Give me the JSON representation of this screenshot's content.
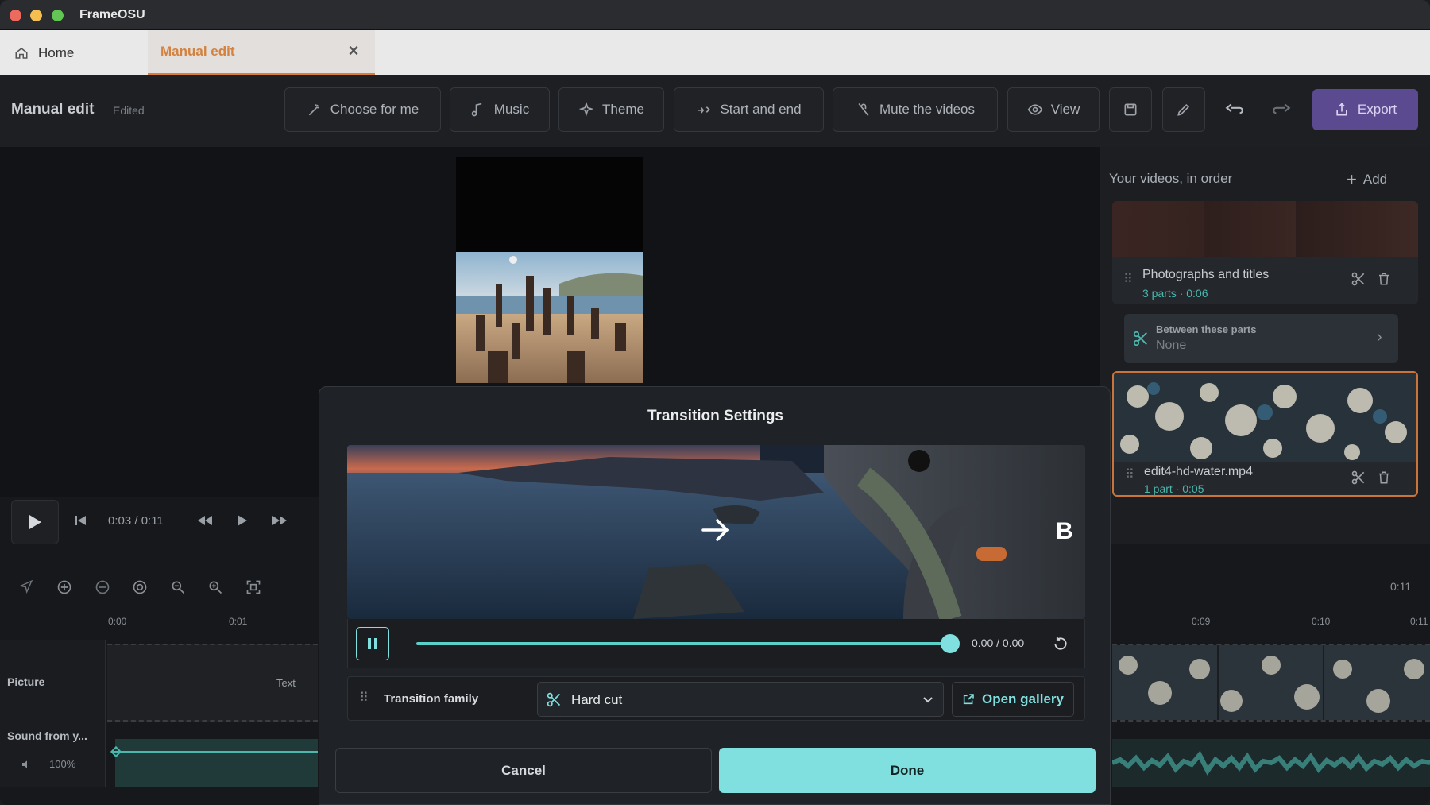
{
  "window": {
    "app_title": "FrameOSU"
  },
  "tabs": [
    {
      "label": "Home"
    },
    {
      "label": "Manual edit"
    }
  ],
  "toolbar": {
    "title": "Manual edit",
    "status": "Edited",
    "buttons": {
      "choose": "Choose for me",
      "music": "Music",
      "theme": "Theme",
      "start_end": "Start and end",
      "mute": "Mute the videos",
      "view": "View",
      "export": "Export"
    }
  },
  "sidebar": {
    "title": "Your videos, in order",
    "add_label": "Add",
    "clips": [
      {
        "name": "Photographs and titles",
        "meta": "3 parts · 0:06"
      },
      {
        "name": "edit4-hd-water.mp4",
        "meta": "1 part · 0:05"
      }
    ],
    "between": {
      "label": "Between these parts",
      "value": "None"
    }
  },
  "transport": {
    "timecode": "0:03 / 0:11"
  },
  "timeline": {
    "ticks_left": [
      "0:00",
      "0:01"
    ],
    "ticks_right": [
      "0:09",
      "0:10",
      "0:11"
    ],
    "end_time": "0:11",
    "tracks": {
      "picture": "Picture",
      "picture_text": "Text",
      "sound": "Sound from y...",
      "sound_volume": "100%"
    }
  },
  "modal": {
    "title": "Transition Settings",
    "player": {
      "time": "0.00 / 0.00",
      "progress": 1.0
    },
    "preview_badge": "B",
    "family_label": "Transition family",
    "family_value": "Hard cut",
    "gallery_label": "Open gallery",
    "cancel_label": "Cancel",
    "done_label": "Done"
  },
  "colors": {
    "accent": "#7fe0df",
    "export": "#5c4a91",
    "active_tab": "#d5823f"
  }
}
